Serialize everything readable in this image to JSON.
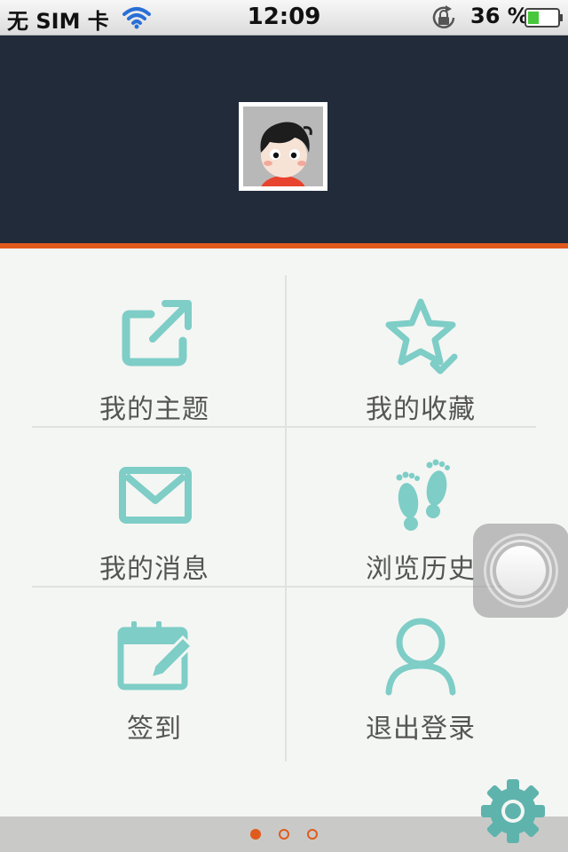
{
  "status_bar": {
    "carrier": "无 SIM 卡",
    "time": "12:09",
    "battery_percent": "36 %",
    "battery_level": 0.36,
    "icons": [
      "wifi-icon",
      "rotation-lock-icon",
      "battery-icon"
    ]
  },
  "profile": {
    "avatar_icon": "cartoon-avatar"
  },
  "menu": {
    "items": [
      {
        "label": "我的主题",
        "icon": "share-icon"
      },
      {
        "label": "我的收藏",
        "icon": "star-check-icon"
      },
      {
        "label": "我的消息",
        "icon": "envelope-icon"
      },
      {
        "label": "浏览历史",
        "icon": "footprints-icon"
      },
      {
        "label": "签到",
        "icon": "calendar-edit-icon"
      },
      {
        "label": "退出登录",
        "icon": "user-icon"
      }
    ]
  },
  "pager": {
    "page_count": 3,
    "current_page": 1
  },
  "colors": {
    "header_bg": "#222b39",
    "accent": "#e15a1d",
    "icon_teal": "#7ecdc7",
    "content_bg": "#f4f6f3"
  }
}
